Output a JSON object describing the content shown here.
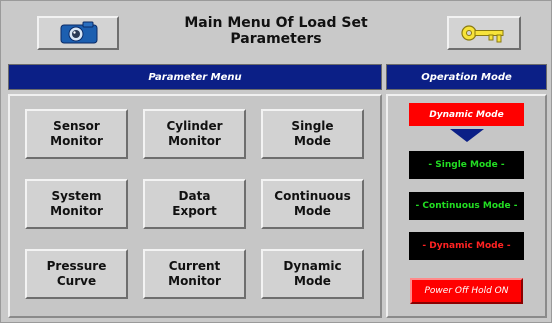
{
  "header": {
    "title": "Main Menu Of Load Set Parameters",
    "left_icon": "camera-icon",
    "right_icon": "key-icon"
  },
  "parameter_menu": {
    "title": "Parameter Menu",
    "buttons": [
      {
        "label": "Sensor\nMonitor"
      },
      {
        "label": "Cylinder\nMonitor"
      },
      {
        "label": "Single\nMode"
      },
      {
        "label": "System\nMonitor"
      },
      {
        "label": "Data\nExport"
      },
      {
        "label": "Continuous\nMode"
      },
      {
        "label": "Pressure\nCurve"
      },
      {
        "label": "Current\nMonitor"
      },
      {
        "label": "Dynamic\nMode"
      }
    ]
  },
  "operation_mode": {
    "title": "Operation Mode",
    "current_mode": "Dynamic Mode",
    "modes": [
      {
        "label": "- Single Mode -",
        "color": "#22dd22"
      },
      {
        "label": "- Continuous Mode -",
        "color": "#22dd22"
      },
      {
        "label": "- Dynamic Mode -",
        "color": "#ff2222"
      }
    ],
    "power_off_label": "Power Off Hold ON"
  },
  "colors": {
    "header_bar": "#0b1f86",
    "alert_red": "#ff0000",
    "mode_green": "#22dd22",
    "background": "#c9c9c9"
  }
}
